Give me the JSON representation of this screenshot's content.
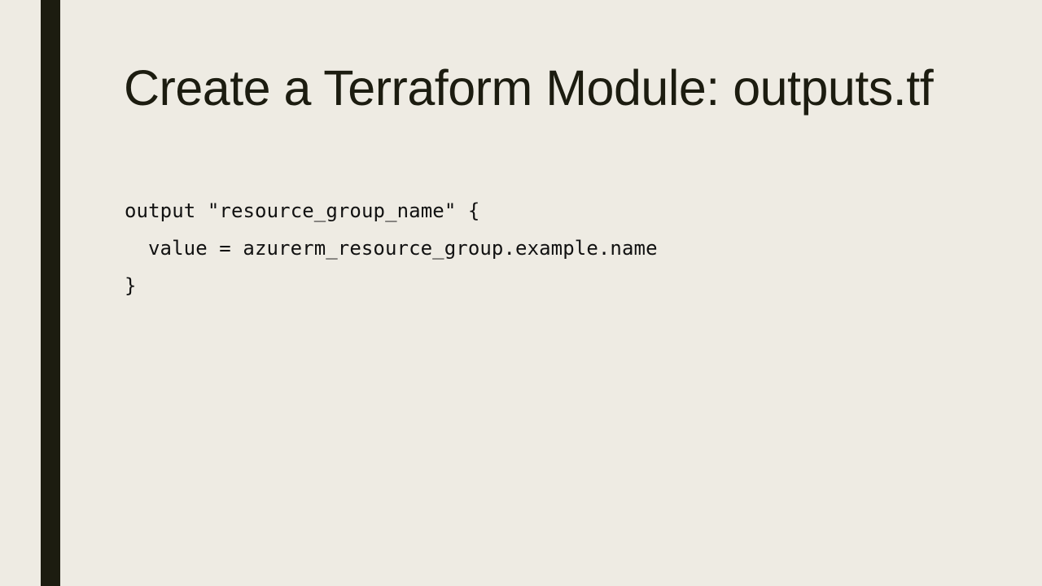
{
  "slide": {
    "title": "Create a Terraform Module: outputs.tf",
    "code_lines": [
      "output \"resource_group_name\" {",
      "value = azurerm_resource_group.example.name",
      "}"
    ]
  },
  "colors": {
    "background": "#EEEBE3",
    "accent_bar": "#1C1C10",
    "text": "#1C1C10"
  }
}
